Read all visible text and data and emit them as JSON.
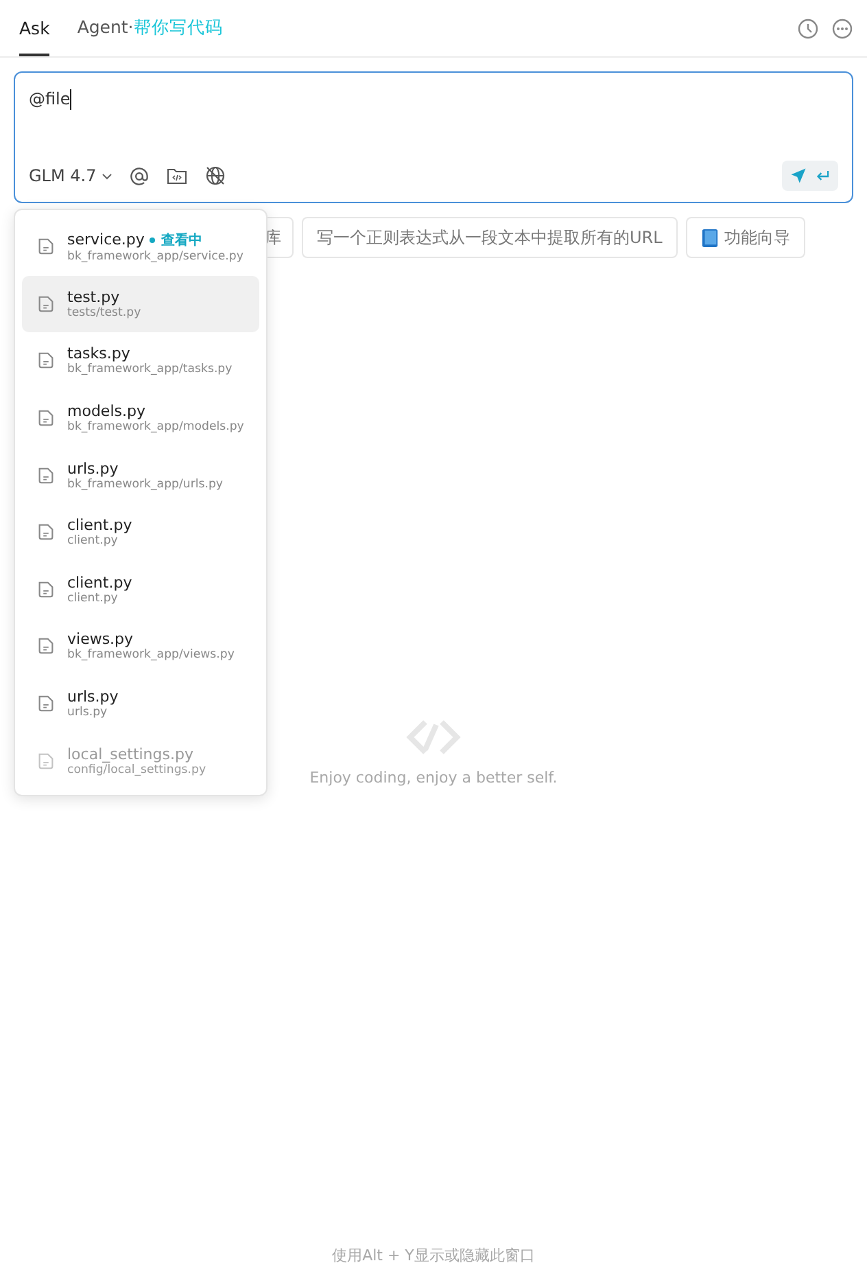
{
  "tabs": [
    {
      "label": "Ask",
      "selected": true
    },
    {
      "label": "Agent·",
      "accent": "帮你写代码",
      "selected": false
    }
  ],
  "input": {
    "value": "@file",
    "model": "GLM 4.7"
  },
  "suggestions": [
    "库",
    "写一个正则表达式从一段文本中提取所有的URL",
    "功能向导"
  ],
  "files": [
    {
      "name": "service.py",
      "path": "bk_framework_app/service.py",
      "badge": "查看中",
      "selected": false,
      "dimmed": false
    },
    {
      "name": "test.py",
      "path": "tests/test.py",
      "selected": true,
      "dimmed": false
    },
    {
      "name": "tasks.py",
      "path": "bk_framework_app/tasks.py",
      "selected": false,
      "dimmed": false
    },
    {
      "name": "models.py",
      "path": "bk_framework_app/models.py",
      "selected": false,
      "dimmed": false
    },
    {
      "name": "urls.py",
      "path": "bk_framework_app/urls.py",
      "selected": false,
      "dimmed": false
    },
    {
      "name": "client.py",
      "path": "client.py",
      "selected": false,
      "dimmed": false
    },
    {
      "name": "client.py",
      "path": "client.py",
      "selected": false,
      "dimmed": false
    },
    {
      "name": "views.py",
      "path": "bk_framework_app/views.py",
      "selected": false,
      "dimmed": false
    },
    {
      "name": "urls.py",
      "path": "urls.py",
      "selected": false,
      "dimmed": false
    },
    {
      "name": "local_settings.py",
      "path": "config/local_settings.py",
      "selected": false,
      "dimmed": true
    }
  ],
  "empty_state": "Enjoy coding, enjoy a better self.",
  "footer": "使用Alt + Y显示或隐藏此窗口"
}
